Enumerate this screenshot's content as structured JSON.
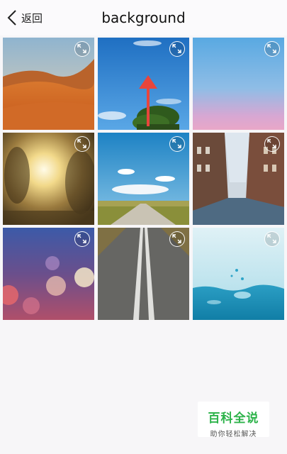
{
  "header": {
    "back_label": "返回",
    "title": "background"
  },
  "tiles": [
    {
      "name": "desert",
      "icon": "expand-icon"
    },
    {
      "name": "sky-tree-arrow",
      "icon": "expand-icon"
    },
    {
      "name": "gradient-sky",
      "icon": "expand-icon"
    },
    {
      "name": "sunlight",
      "icon": "expand-icon"
    },
    {
      "name": "road-clouds",
      "icon": "expand-icon"
    },
    {
      "name": "city-street",
      "icon": "expand-icon"
    },
    {
      "name": "bokeh",
      "icon": "expand-icon"
    },
    {
      "name": "road-lines",
      "icon": "expand-icon"
    },
    {
      "name": "water-splash",
      "icon": "expand-icon"
    }
  ],
  "watermark": {
    "title": "百科全说",
    "subtitle": "助你轻松解决"
  },
  "colors": {
    "watermark_green": "#2db34a",
    "arrow_red": "#e8453c"
  }
}
